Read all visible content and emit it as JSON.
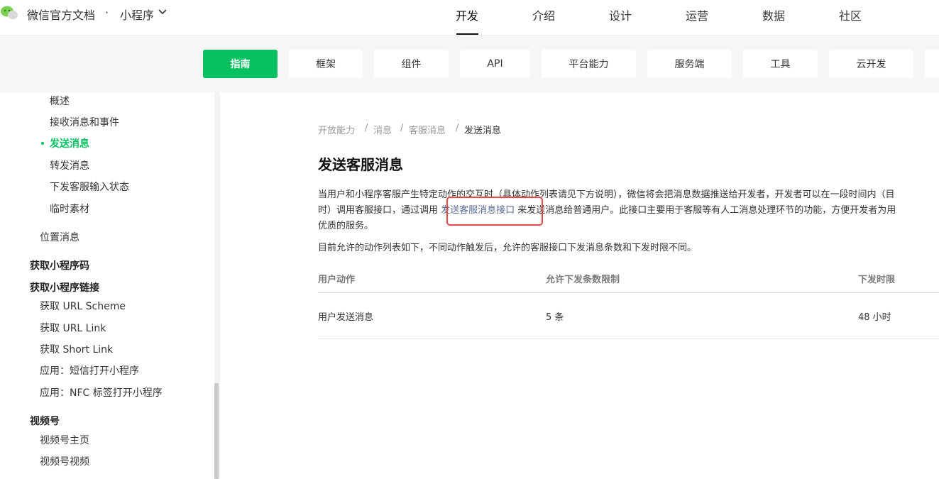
{
  "brand": {
    "name": "微信官方文档",
    "separator": "·",
    "product": "小程序"
  },
  "top_nav": [
    "开发",
    "介绍",
    "设计",
    "运营",
    "数据",
    "社区"
  ],
  "sub_nav": [
    "指南",
    "框架",
    "组件",
    "API",
    "平台能力",
    "服务端",
    "工具",
    "云开发"
  ],
  "sidebar": {
    "items": [
      "概述",
      "接收消息和事件",
      "发送消息",
      "转发消息",
      "下发客服输入状态",
      "临时素材",
      "位置消息",
      "获取小程序码",
      "获取小程序链接",
      "获取 URL Scheme",
      "获取 URL Link",
      "获取 Short Link",
      "应用：短信打开小程序",
      "应用：NFC 标签打开小程序",
      "视频号",
      "视频号主页",
      "视频号视频"
    ]
  },
  "breadcrumb": [
    "开放能力",
    "/",
    "消息",
    "/",
    "客服消息",
    "/",
    "发送消息"
  ],
  "page_title": "发送客服消息",
  "body": {
    "line1": "当用户和小程序客服产生特定动作的交互时（具体动作列表请见下方说明），微信将会把消息数据推送给开发者，开发者可以在一段时间内（目",
    "line2_before": "时）调用客服接口，通过调用 ",
    "line2_link": "发送客服消息接口",
    "line2_after": " 来发送消息给普通用户。此接口主要用于客服等有人工消息处理环节的功能，方便开发者为用",
    "line3": "优质的服务。",
    "line4": "目前允许的动作列表如下，不同动作触发后，允许的客服接口下发消息条数和下发时限不同。"
  },
  "table": {
    "headers": [
      "用户动作",
      "允许下发条数限制",
      "下发时限"
    ],
    "rows": [
      [
        "用户发送消息",
        "5 条",
        "48 小时"
      ]
    ]
  },
  "colors": {
    "accent": "#07c160",
    "link": "#576b95",
    "highlight": "#e5484d"
  },
  "icons": {
    "logo": "wechat-logo-icon",
    "caret": "chevron-down-icon"
  }
}
